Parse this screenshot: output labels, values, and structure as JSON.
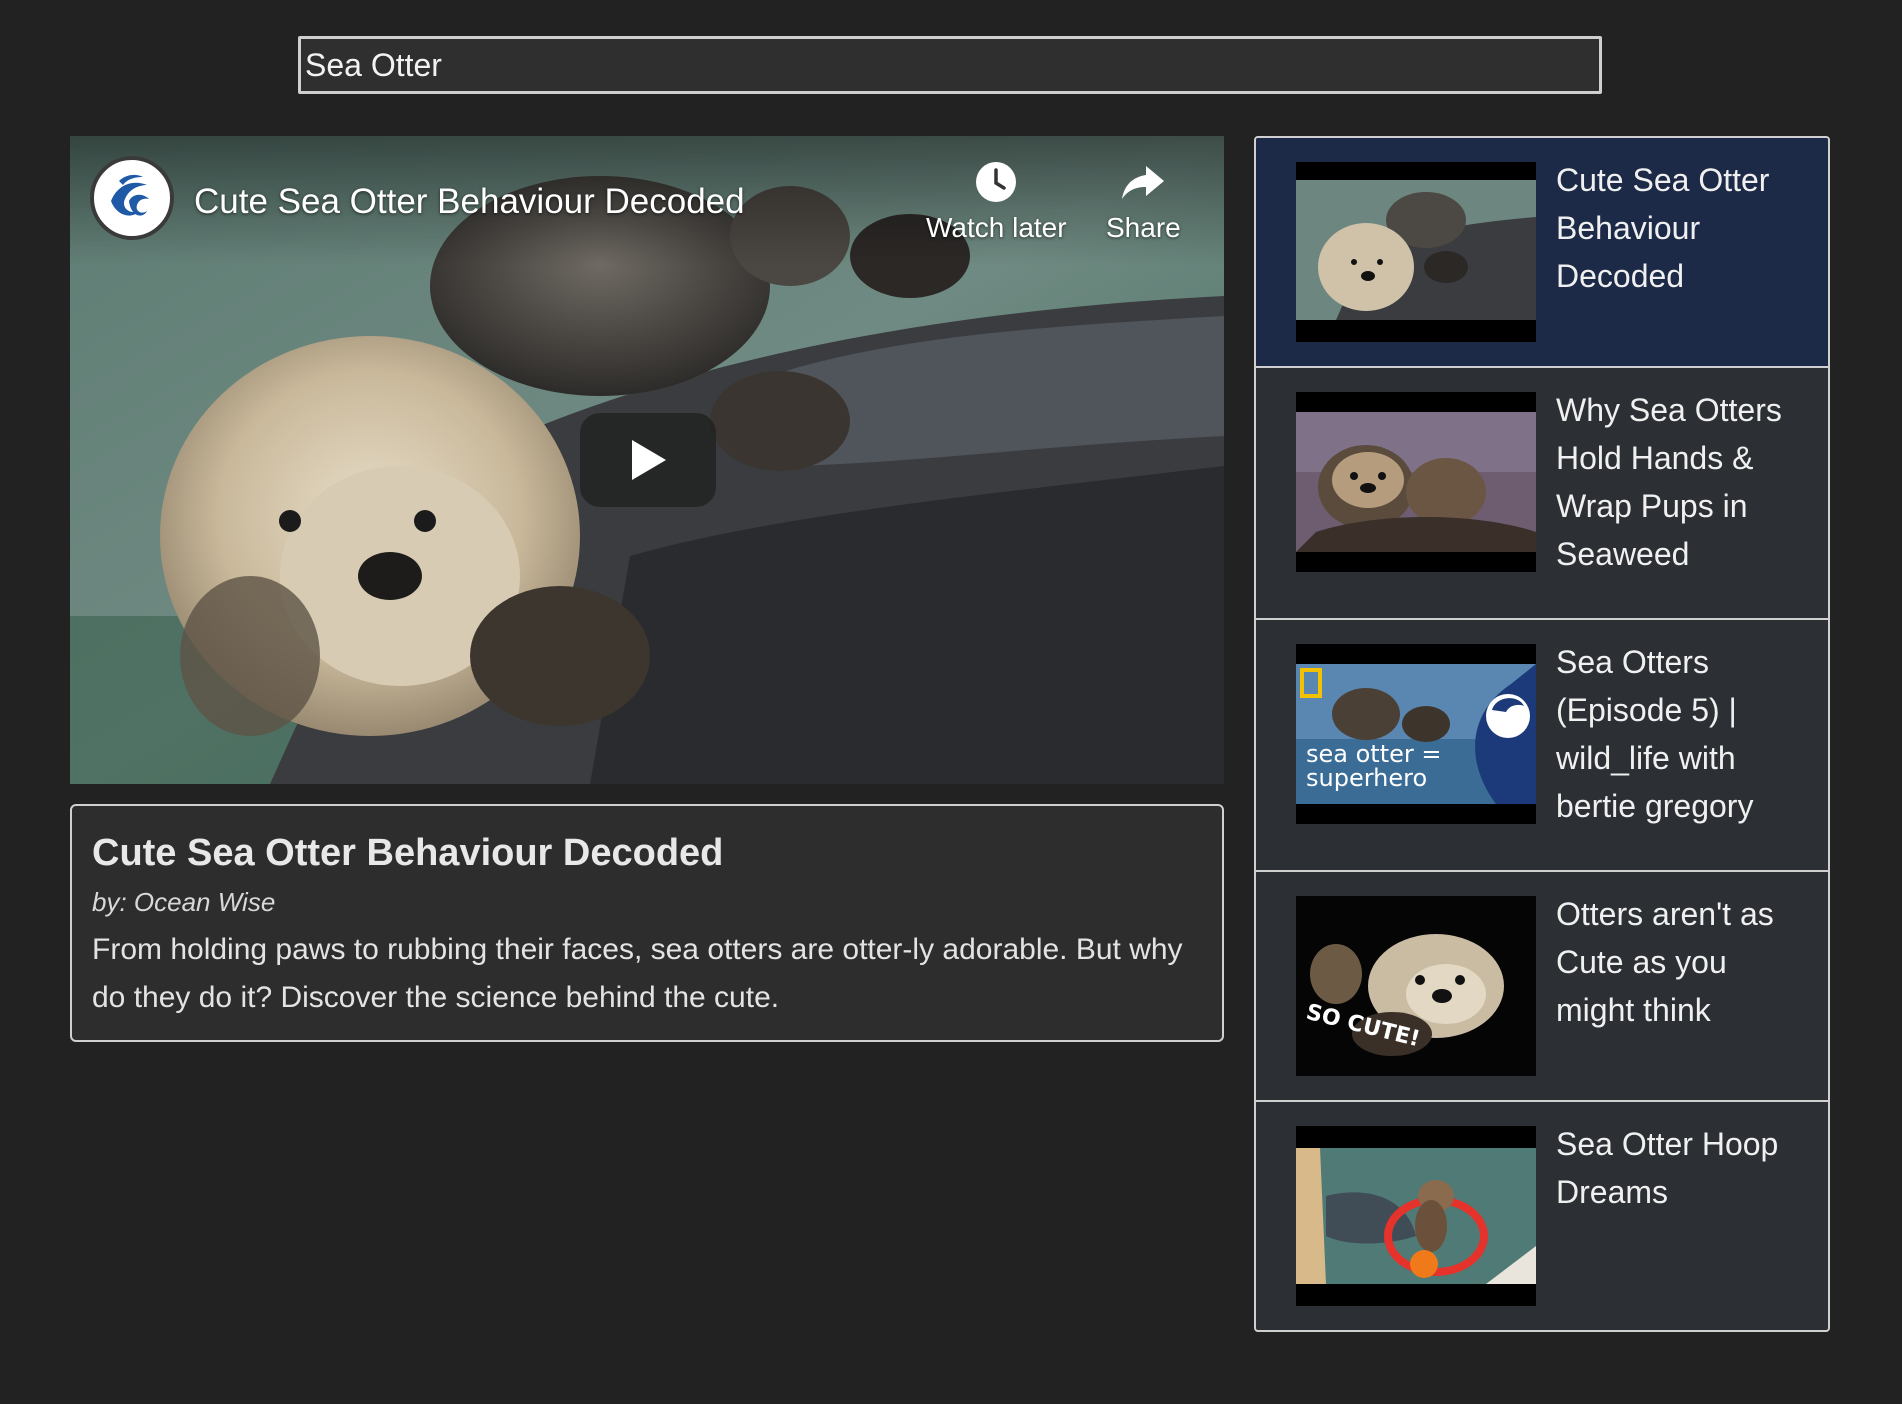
{
  "search": {
    "value": "Sea Otter",
    "placeholder": ""
  },
  "player": {
    "title": "Cute Sea Otter Behaviour Decoded",
    "watch_later_label": "Watch later",
    "share_label": "Share",
    "icons": [
      "channel-logo",
      "clock-icon",
      "share-arrow-icon",
      "play-icon"
    ]
  },
  "details": {
    "title": "Cute Sea Otter Behaviour Decoded",
    "author": "by: Ocean Wise",
    "description": "From holding paws to rubbing their faces, sea otters are otter-ly adorable. But why do they do it? Discover the science behind the cute."
  },
  "playlist": {
    "items": [
      {
        "title": "Cute Sea Otter Behaviour Decoded",
        "active": true
      },
      {
        "title": "Why Sea Otters Hold Hands & Wrap Pups in Seaweed",
        "active": false
      },
      {
        "title": "Sea Otters (Episode 5) | wild_life with bertie gregory",
        "active": false,
        "thumb_text": "sea otter = superhero"
      },
      {
        "title": "Otters aren't as Cute as you might think",
        "active": false,
        "thumb_text": "SO CUTE!"
      },
      {
        "title": "Sea Otter Hoop Dreams",
        "active": false
      }
    ]
  },
  "colors": {
    "background": "#222222",
    "panel": "#2c2f33",
    "active_item": "#1c2a47",
    "border": "#d0d0d0",
    "channel_blue": "#1f5aa6"
  }
}
